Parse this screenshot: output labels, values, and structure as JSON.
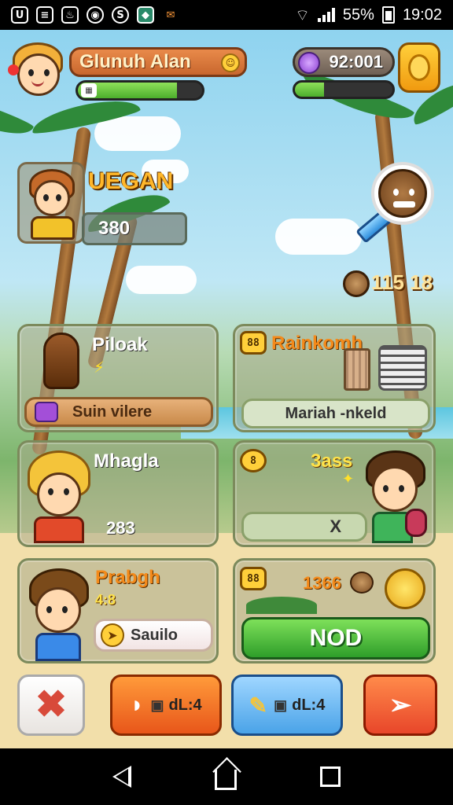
{
  "status_bar": {
    "left_icons": [
      "U",
      "≡",
      "♨",
      "◉",
      "S",
      "◆",
      "✉"
    ],
    "battery": "55%",
    "time": "19:02"
  },
  "hud": {
    "player_name": "Glunuh Alan",
    "player_xp_fraction": 0.8,
    "currency_value": "92:001",
    "energy_fraction": 0.3
  },
  "hero": {
    "title": "UEGAN",
    "score": "380"
  },
  "resource": {
    "count": "115 18"
  },
  "panels": {
    "top_left": {
      "title": "Piloak",
      "button_label": "Suin vilere"
    },
    "top_right": {
      "badge": "88",
      "title": "Rainkomh",
      "button_label": "Mariah -nkeld"
    },
    "mid_left": {
      "title": "Mhagla",
      "value": "283"
    },
    "mid_right": {
      "badge": "8",
      "title": "3ass",
      "button_label": "X"
    },
    "bottom_left": {
      "title": "Prabgh",
      "subtitle": "4:8",
      "button_label": "Sauilo"
    },
    "bottom_right": {
      "badge": "88",
      "value": "1366",
      "button_label": "NOD"
    }
  },
  "bottom_bar": {
    "btn_orange_label": "dL:4",
    "btn_blue_label": "dL:4"
  },
  "colors": {
    "accent_orange": "#f06a1e",
    "accent_blue": "#4aa3e8",
    "accent_green": "#3fbf3a",
    "accent_red": "#e8462a"
  }
}
